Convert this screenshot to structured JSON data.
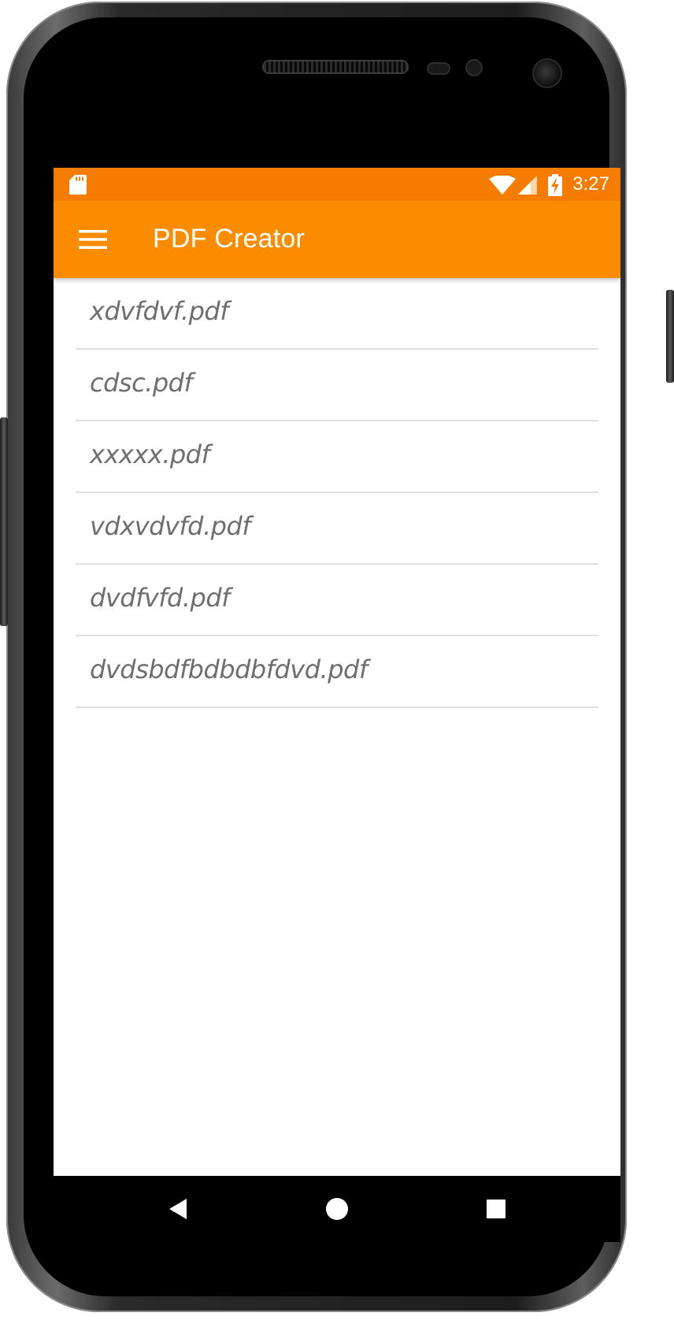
{
  "status_bar": {
    "time": "3:27",
    "icons": [
      "sd-card-icon",
      "wifi-icon",
      "cell-signal-icon",
      "battery-charging-icon"
    ]
  },
  "app_bar": {
    "title": "PDF Creator",
    "menu_icon": "hamburger-menu-icon"
  },
  "files": [
    {
      "name": "xdvfdvf.pdf"
    },
    {
      "name": "cdsc.pdf"
    },
    {
      "name": "xxxxx.pdf"
    },
    {
      "name": "vdxvdvfd.pdf"
    },
    {
      "name": "dvdfvfd.pdf"
    },
    {
      "name": "dvdsbdfbdbdbfdvd.pdf"
    }
  ],
  "nav_bar": {
    "icons": [
      "back-icon",
      "home-icon",
      "recent-apps-icon"
    ]
  },
  "colors": {
    "status_bar": "#f57c00",
    "app_bar": "#fb8c00",
    "file_text": "#6e6e6e",
    "divider": "#e0e0e0"
  }
}
